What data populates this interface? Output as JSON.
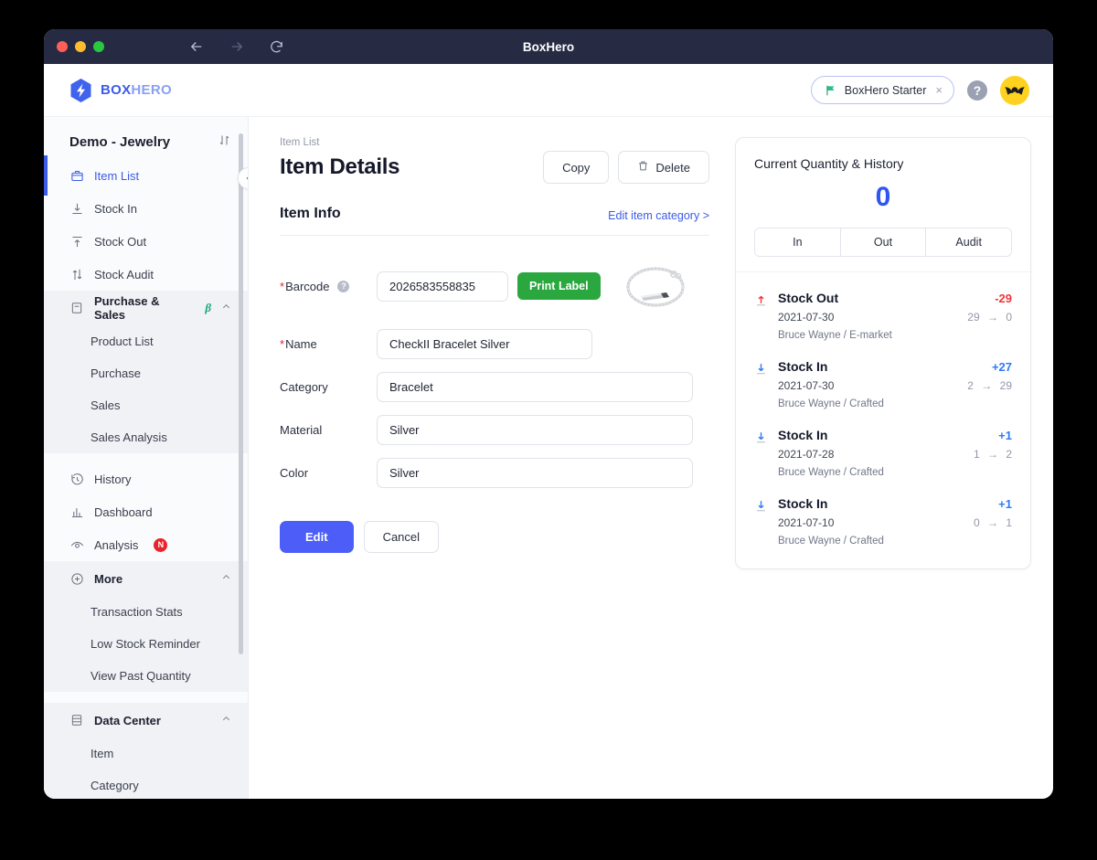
{
  "window": {
    "title": "BoxHero",
    "nav": {
      "back_icon": "arrow-left-icon",
      "forward_icon": "arrow-right-icon",
      "reload_icon": "reload-icon"
    }
  },
  "header": {
    "logo_bold": "BOX",
    "logo_light": "HERO",
    "plan_badge": {
      "label": "BoxHero Starter",
      "flag_icon": "green-flag-icon",
      "close": "×"
    },
    "help_label": "?",
    "avatar_icon": "batman-avatar-icon",
    "accent": "#3c5ce8"
  },
  "sidebar": {
    "workspace": "Demo - Jewelry",
    "sort_icon": "sort-icon",
    "collapse_icon": "chevron-left-icon",
    "items": [
      {
        "label": "Item List",
        "icon": "box-icon",
        "active": true
      },
      {
        "label": "Stock In",
        "icon": "stock-in-icon",
        "active": false
      },
      {
        "label": "Stock Out",
        "icon": "stock-out-icon",
        "active": false
      },
      {
        "label": "Stock Audit",
        "icon": "stock-audit-icon",
        "active": false
      }
    ],
    "group_purchase": {
      "label": "Purchase & Sales",
      "icon": "clipboard-icon",
      "beta": "β",
      "chevron": "chevron-up-icon",
      "children": [
        "Product List",
        "Purchase",
        "Sales",
        "Sales Analysis"
      ]
    },
    "items2": [
      {
        "label": "History",
        "icon": "history-icon"
      },
      {
        "label": "Dashboard",
        "icon": "chart-bar-icon"
      },
      {
        "label": "Analysis",
        "icon": "eye-icon",
        "badge": "N"
      }
    ],
    "group_more": {
      "label": "More",
      "icon": "plus-circle-icon",
      "chevron": "chevron-up-icon",
      "children": [
        "Transaction Stats",
        "Low Stock Reminder",
        "View Past Quantity"
      ]
    },
    "group_data": {
      "label": "Data Center",
      "icon": "database-icon",
      "chevron": "chevron-up-icon",
      "children": [
        "Item",
        "Category"
      ]
    }
  },
  "main": {
    "breadcrumb": "Item List",
    "page_title": "Item Details",
    "copy_label": "Copy",
    "delete_label": "Delete",
    "delete_icon": "trash-icon",
    "section_title": "Item Info",
    "edit_category_link": "Edit item category >",
    "fields": [
      {
        "label": "Barcode",
        "required": true,
        "help": "?",
        "value": "2026583558835"
      },
      {
        "label": "Name",
        "required": true,
        "value": "CheckII Bracelet Silver"
      },
      {
        "label": "Category",
        "required": false,
        "value": "Bracelet"
      },
      {
        "label": "Material",
        "required": false,
        "value": "Silver"
      },
      {
        "label": "Color",
        "required": false,
        "value": "Silver"
      }
    ],
    "print_label": "Print Label",
    "thumbnail_icon": "silver-bracelet-photo",
    "edit_button": "Edit",
    "cancel_button": "Cancel"
  },
  "history_panel": {
    "title": "Current Quantity & History",
    "current_quantity": "0",
    "tabs": [
      "In",
      "Out",
      "Audit"
    ],
    "entries": [
      {
        "type": "Stock Out",
        "icon": "arrow-up-red-icon",
        "delta": "-29",
        "delta_sign": "neg",
        "date": "2021-07-30",
        "from": "29",
        "to": "0",
        "who": "Bruce Wayne / E-market"
      },
      {
        "type": "Stock In",
        "icon": "arrow-down-blue-icon",
        "delta": "+27",
        "delta_sign": "pos",
        "date": "2021-07-30",
        "from": "2",
        "to": "29",
        "who": "Bruce Wayne / Crafted"
      },
      {
        "type": "Stock In",
        "icon": "arrow-down-blue-icon",
        "delta": "+1",
        "delta_sign": "pos",
        "date": "2021-07-28",
        "from": "1",
        "to": "2",
        "who": "Bruce Wayne / Crafted"
      },
      {
        "type": "Stock In",
        "icon": "arrow-down-blue-icon",
        "delta": "+1",
        "delta_sign": "pos",
        "date": "2021-07-10",
        "from": "0",
        "to": "1",
        "who": "Bruce Wayne / Crafted"
      }
    ]
  }
}
